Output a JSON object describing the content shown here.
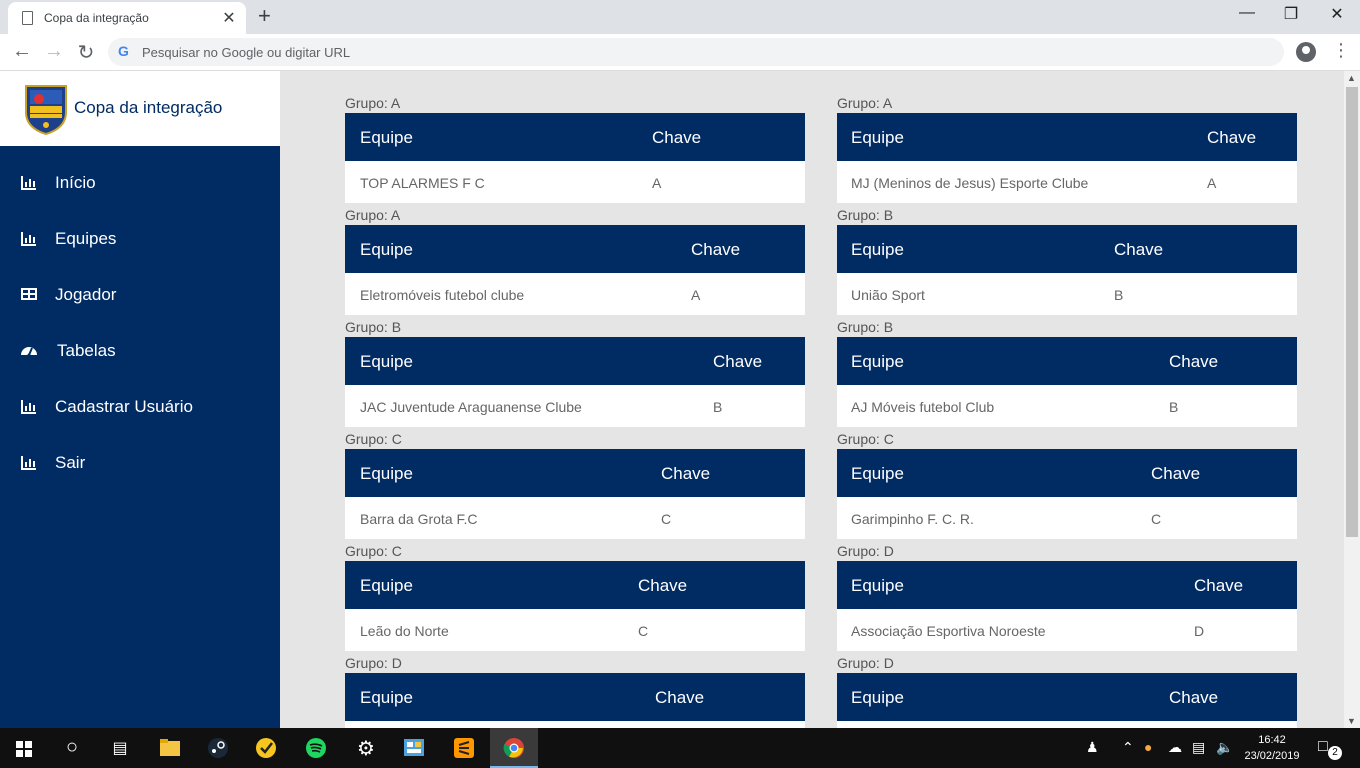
{
  "browser": {
    "tab_title": "Copa da integração",
    "new_tab": "+",
    "close_tab": "✕",
    "omnibox_placeholder": "Pesquisar no Google ou digitar URL",
    "window_controls": [
      "minimize",
      "maximize",
      "close"
    ]
  },
  "sidebar": {
    "brand": "Copa da integração",
    "logo_text": "COPA DA INTEGRAÇÃO",
    "items": [
      {
        "label": "Início",
        "icon": "bar-chart-icon"
      },
      {
        "label": "Equipes",
        "icon": "bar-chart-icon"
      },
      {
        "label": "Jogador",
        "icon": "table-icon"
      },
      {
        "label": "Tabelas",
        "icon": "dashboard-icon"
      },
      {
        "label": "Cadastrar Usuário",
        "icon": "bar-chart-icon"
      },
      {
        "label": "Sair",
        "icon": "bar-chart-icon"
      }
    ]
  },
  "table_headers": {
    "team": "Equipe",
    "key": "Chave"
  },
  "groups_left": [
    {
      "grupo": "Grupo: A",
      "equipe": "TOP ALARMES F C",
      "chave": "A"
    },
    {
      "grupo": "Grupo: A",
      "equipe": "Eletromóveis futebol clube",
      "chave": "A"
    },
    {
      "grupo": "Grupo: B",
      "equipe": "JAC Juventude Araguanense Clube",
      "chave": "B"
    },
    {
      "grupo": "Grupo: C",
      "equipe": "Barra da Grota F.C",
      "chave": "C"
    },
    {
      "grupo": "Grupo: C",
      "equipe": "Leão do Norte",
      "chave": "C"
    },
    {
      "grupo": "Grupo: D",
      "equipe": "",
      "chave": ""
    }
  ],
  "groups_right": [
    {
      "grupo": "Grupo: A",
      "equipe": "MJ (Meninos de Jesus) Esporte Clube",
      "chave": "A"
    },
    {
      "grupo": "Grupo: B",
      "equipe": "União Sport",
      "chave": "B"
    },
    {
      "grupo": "Grupo: B",
      "equipe": "AJ Móveis futebol Club",
      "chave": "B"
    },
    {
      "grupo": "Grupo: C",
      "equipe": "Garimpinho F. C. R.",
      "chave": "C"
    },
    {
      "grupo": "Grupo: D",
      "equipe": "Associação Esportiva Noroeste",
      "chave": "D"
    },
    {
      "grupo": "Grupo: D",
      "equipe": "",
      "chave": ""
    }
  ],
  "taskbar": {
    "time": "16:42",
    "date": "23/02/2019",
    "notifications": "2"
  }
}
